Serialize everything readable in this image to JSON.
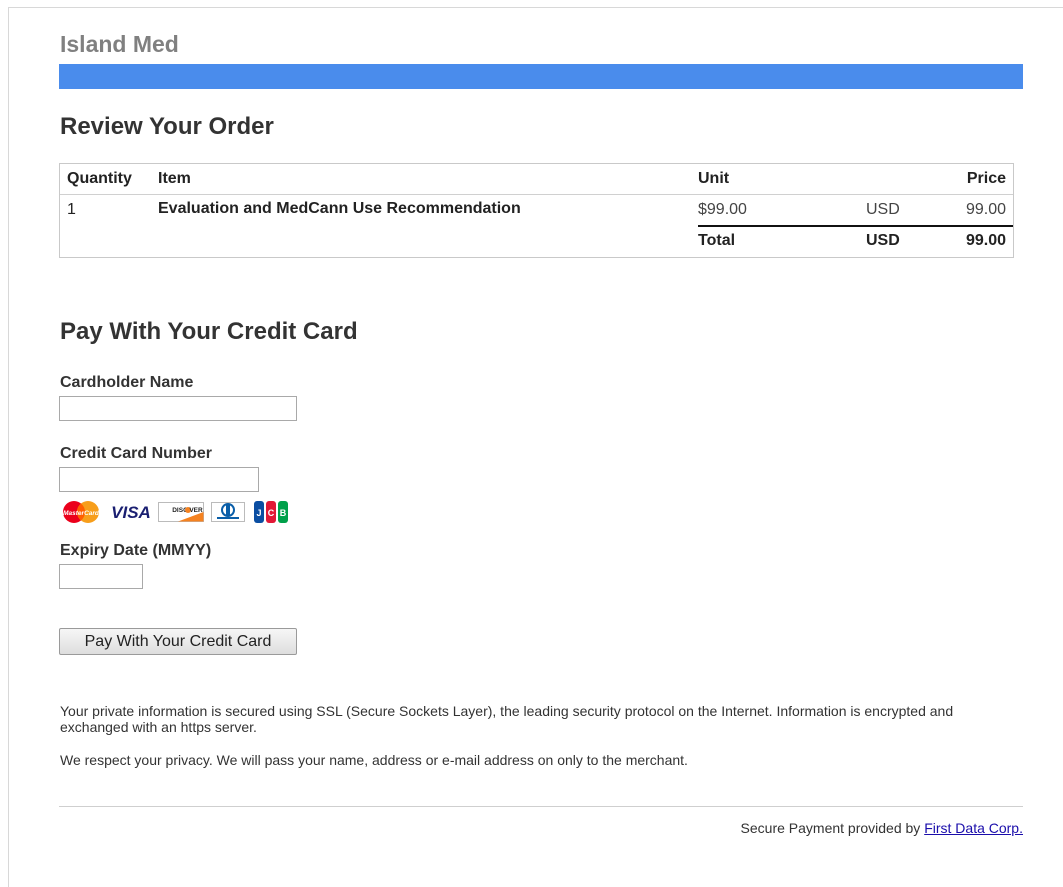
{
  "merchant": {
    "name": "Island Med",
    "brand_color": "#4a8cec"
  },
  "review": {
    "title": "Review Your Order",
    "headers": {
      "quantity": "Quantity",
      "item": "Item",
      "unit": "Unit",
      "price": "Price"
    },
    "rows": [
      {
        "quantity": "1",
        "item": "Evaluation and MedCann Use Recommendation",
        "unit": "$99.00",
        "currency": "USD",
        "price": "99.00"
      }
    ],
    "total": {
      "label": "Total",
      "currency": "USD",
      "amount": "99.00"
    }
  },
  "payment": {
    "title": "Pay With Your Credit Card",
    "cardholder_label": "Cardholder Name",
    "cardholder_value": "",
    "card_number_label": "Credit Card Number",
    "card_number_value": "",
    "expiry_label": "Expiry Date (MMYY)",
    "expiry_value": "",
    "accepted_cards": [
      "mastercard-icon",
      "visa-icon",
      "discover-icon",
      "diners-club-icon",
      "jcb-icon"
    ],
    "submit_label": "Pay With Your Credit Card"
  },
  "notes": {
    "security": "Your private information is secured using SSL (Secure Sockets Layer), the leading security protocol on the Internet. Information is encrypted and exchanged with an https server.",
    "privacy": "We respect your privacy. We will pass your name, address or e-mail address on only to the merchant."
  },
  "footer": {
    "text": "Secure Payment provided by",
    "link_label": "First Data Corp."
  }
}
